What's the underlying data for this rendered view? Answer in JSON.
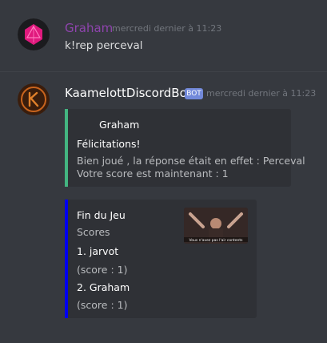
{
  "messages": [
    {
      "author": "Graham",
      "timestamp": "mercredi dernier à 11:23",
      "content": "k!rep perceval",
      "author_color": "#8e44ad"
    },
    {
      "author": "KaamelottDiscordBot",
      "badge": "BOT",
      "timestamp": "mercredi dernier à 11:23",
      "author_color": "#ffffff",
      "embeds": [
        {
          "accent": "#43b581",
          "author": "Graham",
          "title": "Félicitations!",
          "lines": [
            "Bien joué , la réponse était en effet : Perceval",
            "Votre score est maintenant : 1"
          ]
        },
        {
          "accent": "#0000ee",
          "title": "Fin du Jeu",
          "subtitle": "Scores",
          "entries": [
            {
              "name": "1. jarvot",
              "score": "(score : 1)"
            },
            {
              "name": "2. Graham",
              "score": "(score : 1)"
            }
          ],
          "thumbnail_caption": "Vous n'avez pas l'air contents"
        }
      ]
    }
  ]
}
